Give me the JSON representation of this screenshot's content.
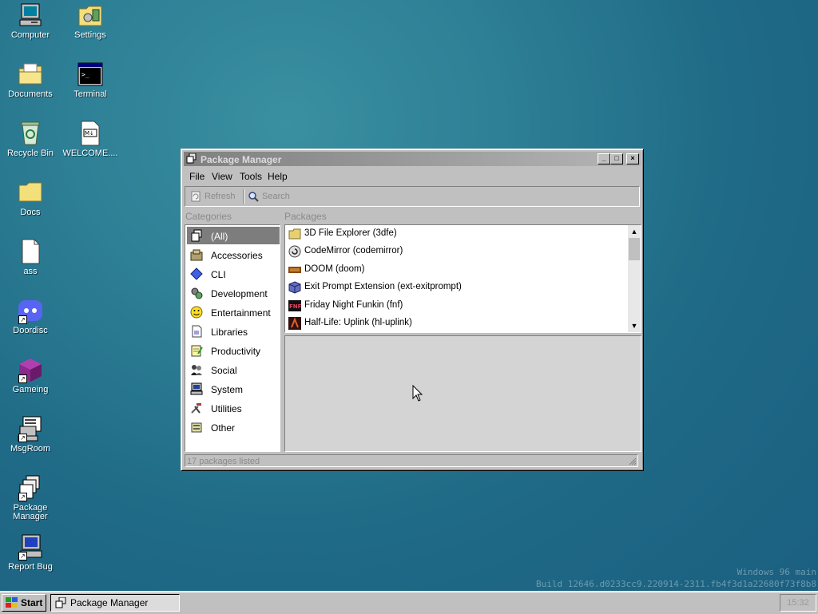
{
  "desktop": {
    "icons": [
      {
        "label": "Computer",
        "icon": "computer-icon"
      },
      {
        "label": "Settings",
        "icon": "settings-icon"
      },
      {
        "label": "Documents",
        "icon": "documents-folder-icon"
      },
      {
        "label": "Terminal",
        "icon": "terminal-icon"
      },
      {
        "label": "Recycle Bin",
        "icon": "recycle-bin-icon"
      },
      {
        "label": "WELCOME....",
        "icon": "markdown-file-icon",
        "badge": "M↓"
      },
      {
        "label": "Docs",
        "icon": "folder-icon"
      },
      {
        "label": "ass",
        "icon": "blank-file-icon"
      },
      {
        "label": "Doordisc",
        "icon": "discord-icon"
      },
      {
        "label": "Gameing",
        "icon": "cube-icon"
      },
      {
        "label": "MsgRoom",
        "icon": "msgroom-icon"
      },
      {
        "label": "Package Manager",
        "icon": "package-manager-icon"
      },
      {
        "label": "Report Bug",
        "icon": "report-bug-icon"
      }
    ]
  },
  "window": {
    "title": "Package Manager",
    "controls": {
      "minimize": "_",
      "maximize": "□",
      "close": "×"
    },
    "menu": [
      "File",
      "View",
      "Tools",
      "Help"
    ],
    "toolbar": {
      "refresh": "Refresh",
      "search": "Search"
    },
    "categories_header": "Categories",
    "packages_header": "Packages",
    "categories": [
      "(All)",
      "Accessories",
      "CLI",
      "Development",
      "Entertainment",
      "Libraries",
      "Productivity",
      "Social",
      "System",
      "Utilities",
      "Other"
    ],
    "selected_category": "(All)",
    "packages": [
      "3D File Explorer (3dfe)",
      "CodeMirror (codemirror)",
      "DOOM (doom)",
      "Exit Prompt Extension (ext-exitprompt)",
      "Friday Night Funkin (fnf)",
      "Half-Life: Uplink (hl-uplink)"
    ],
    "status": "17 packages listed"
  },
  "watermark": {
    "line1": "Windows 96 main",
    "line2": "Build 12646.d0233cc9.220914-2311.fb4f3d1a22680f73f8b8"
  },
  "taskbar": {
    "start_label": "Start",
    "task_label": "Package Manager",
    "clock": "15:32"
  },
  "colors": {
    "desktop": "#2d7f95",
    "window": "#c0c0c0",
    "selection": "#7d7d7d"
  }
}
